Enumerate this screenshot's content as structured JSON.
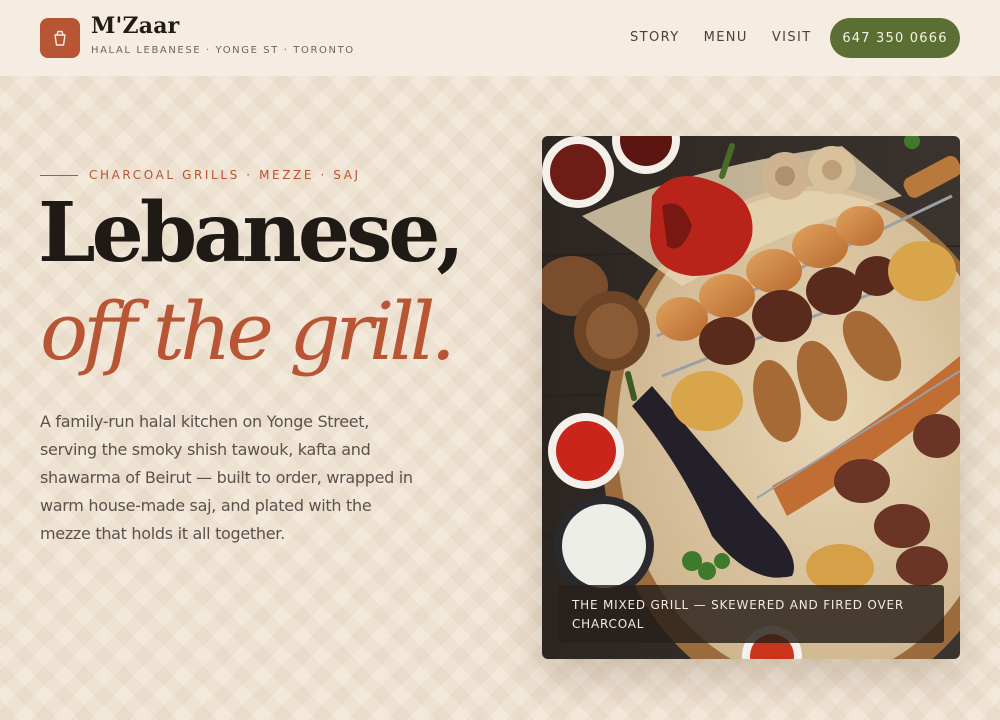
{
  "brand": {
    "name": "M'Zaar",
    "tagline": "HALAL LEBANESE · YONGE ST · TORONTO",
    "logo_icon": "takeout-box-icon",
    "accent": "#b85534"
  },
  "nav": {
    "items": [
      {
        "label": "STORY"
      },
      {
        "label": "MENU"
      },
      {
        "label": "VISIT"
      }
    ],
    "phone": "647 350 0666",
    "phone_color": "#5b6e33"
  },
  "hero": {
    "eyebrow": "CHARCOAL GRILLS · MEZZE · SAJ",
    "headline_line1": "Lebanese,",
    "headline_line2": "off the grill.",
    "intro": "A family-run halal kitchen on Yonge Street, serving the smoky shish tawouk, kafta and shawarma of Beirut — built to order, wrapped in warm house-made saj, and plated with the mezze that holds it all together.",
    "photo_caption": "THE MIXED GRILL — SKEWERED AND FIRED OVER CHARCOAL"
  }
}
